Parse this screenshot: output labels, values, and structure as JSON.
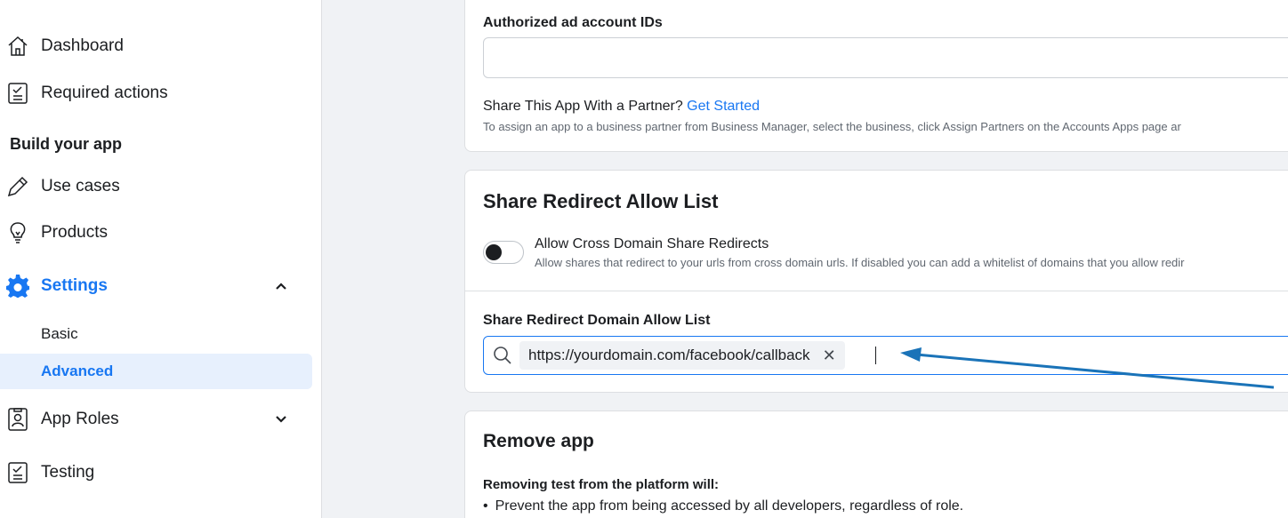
{
  "sidebar": {
    "items_top": [
      {
        "label": "Dashboard",
        "icon": "home-icon"
      },
      {
        "label": "Required actions",
        "icon": "checklist-icon"
      }
    ],
    "build_section_title": "Build your app",
    "build_items": [
      {
        "label": "Use cases",
        "icon": "pencil-icon"
      },
      {
        "label": "Products",
        "icon": "lightbulb-icon"
      }
    ],
    "settings": {
      "label": "Settings",
      "icon": "gear-icon",
      "sub_items": [
        {
          "label": "Basic"
        },
        {
          "label": "Advanced"
        }
      ]
    },
    "app_roles": {
      "label": "App Roles",
      "icon": "id-badge-icon"
    },
    "testing": {
      "label": "Testing",
      "icon": "checklist-icon"
    },
    "accent_color": "#1877f2"
  },
  "authorized": {
    "label": "Authorized ad account IDs",
    "value": "",
    "share_text": "Share This App With a Partner?",
    "share_link": "Get Started",
    "help": "To assign an app to a business partner from Business Manager, select the business, click Assign Partners on the Accounts Apps page ar"
  },
  "share_redirect": {
    "title": "Share Redirect Allow List",
    "toggle_label": "Allow Cross Domain Share Redirects",
    "toggle_on": false,
    "toggle_help": "Allow shares that redirect to your urls from cross domain urls. If disabled you can add a whitelist of domains that you allow redir",
    "domain_list_label": "Share Redirect Domain Allow List",
    "domains": [
      "https://yourdomain.com/facebook/callback"
    ],
    "remove_glyph": "✕"
  },
  "remove_app": {
    "title": "Remove app",
    "subtitle": "Removing test from the platform will:",
    "bullets": [
      "Prevent the app from being accessed by all developers, regardless of role."
    ]
  },
  "annotation": {
    "arrow_color": "#1a73b8"
  }
}
